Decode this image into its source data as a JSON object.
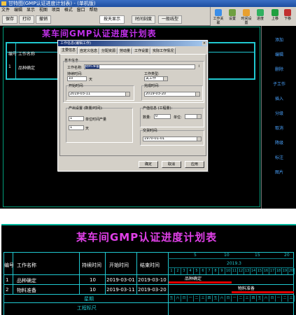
{
  "app": {
    "title": "甘特图(GMP认证进度计划表) - (单机版)",
    "menu": [
      "文件",
      "编辑",
      "显示",
      "视图",
      "项目",
      "格式",
      "窗口",
      "帮助"
    ],
    "toolbar": {
      "zoom_select": "按天显示",
      "timescale_label": "时间刻度",
      "line_label": "一般线型",
      "buttons": [
        "保存",
        "打印",
        "撤销"
      ],
      "right_buttons": [
        "工作关联",
        "设置",
        "时间设置",
        "进度",
        "上移",
        "下移"
      ]
    },
    "side_items": [
      "添加",
      "编辑",
      "删除",
      "子工作",
      "插入",
      "分级",
      "取消",
      "降级",
      "标注",
      "图片"
    ]
  },
  "top_gantt": {
    "title": "某车间GMP认证进度计划表",
    "col_no": "编号",
    "col_name": "工作名称",
    "row1_no": "1",
    "row1_name": "品种确定"
  },
  "dialog": {
    "title": "工作信息(编辑工作)",
    "tabs": [
      "主要信息",
      "自定义信息",
      "分配资源",
      "劳动量",
      "工作设置",
      "实际工作情况"
    ],
    "basic_group": "基本信息:",
    "name_label": "工作名称:",
    "name_value": "物料准备",
    "duration_label": "持续时间:",
    "duration_value": "10",
    "duration_unit": "天",
    "type_label": "工作类型:",
    "type_value": "关工作",
    "start_label": "开始时间:",
    "start_value": "2019-03-11",
    "end_label": "完成时间:",
    "end_value": "2019-03-20",
    "output_group": "产出设置 (数量/时间):",
    "output_value1": "1",
    "output_unit1": "单位时间产量",
    "output_value2": "1",
    "output_unit2": "天",
    "product_group": "产值信息 (工程量):",
    "qty_label": "数量:",
    "qty_value": "0",
    "unit_label": "单位:",
    "deliver_group": "交货时间:",
    "deliver_value": "1970-01-01",
    "ok": "确定",
    "cancel": "取消",
    "apply": "应用"
  },
  "bottom_gantt": {
    "title": "某车间GMP认证进度计划表",
    "headers": {
      "no": "编号",
      "name": "工作名称",
      "duration": "持续时间",
      "start": "开始时间",
      "end": "结束时间"
    },
    "month": "2019.3",
    "days": [
      "1",
      "2",
      "3",
      "4",
      "5",
      "6",
      "7",
      "8",
      "9",
      "10",
      "11",
      "12",
      "13",
      "14",
      "15",
      "16",
      "17",
      "18",
      "19",
      "20"
    ],
    "tick_labels": [
      "5",
      "10",
      "15",
      "20"
    ],
    "rows": [
      {
        "no": "1",
        "name": "品种确定",
        "duration": "10",
        "start": "2019-03-01",
        "end": "2019-03-10",
        "bar_label": "品种确定"
      },
      {
        "no": "2",
        "name": "物料准备",
        "duration": "10",
        "start": "2019-03-11",
        "end": "2019-03-20",
        "bar_label": "物料准备"
      }
    ],
    "week_label": "星期",
    "weekdays": [
      "五",
      "六",
      "日",
      "一",
      "二",
      "三",
      "四",
      "五",
      "六",
      "日",
      "一",
      "二",
      "三",
      "四",
      "五",
      "六",
      "日",
      "一",
      "二",
      "三"
    ],
    "scale_label": "工程标尺"
  }
}
